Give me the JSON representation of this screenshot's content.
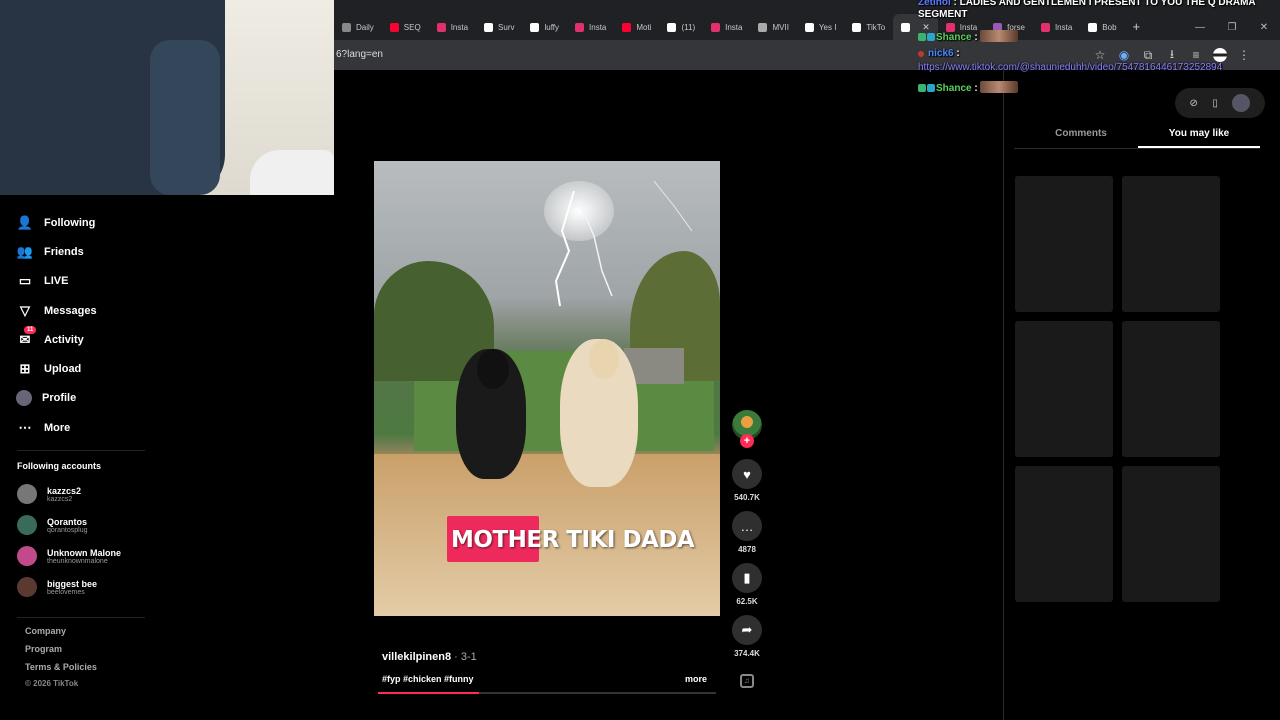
{
  "browser": {
    "tabs": [
      {
        "label": "Daily",
        "color": "#888888"
      },
      {
        "label": "SEQ",
        "color": "#ff0033"
      },
      {
        "label": "Insta",
        "color": "#e1306c"
      },
      {
        "label": "Surv",
        "color": "#ffffff"
      },
      {
        "label": "luffy",
        "color": "#ffffff"
      },
      {
        "label": "Insta",
        "color": "#e1306c"
      },
      {
        "label": "Moti",
        "color": "#ff0033"
      },
      {
        "label": "(11)",
        "color": "#ffffff"
      },
      {
        "label": "Insta",
        "color": "#e1306c"
      },
      {
        "label": "MVII",
        "color": "#aaaaaa"
      },
      {
        "label": "Yes I",
        "color": "#ffffff"
      },
      {
        "label": "TikTo",
        "color": "#ffffff"
      },
      {
        "label": "",
        "color": "#ffffff",
        "active": true
      },
      {
        "label": "Insta",
        "color": "#e1306c"
      },
      {
        "label": "forse",
        "color": "#9b59b6"
      },
      {
        "label": "Insta",
        "color": "#e1306c"
      },
      {
        "label": "Bob",
        "color": "#ffffff"
      }
    ],
    "url": "6?lang=en"
  },
  "sidebar": {
    "nav": [
      {
        "label": "Following",
        "icon": "following-icon"
      },
      {
        "label": "Friends",
        "icon": "friends-icon"
      },
      {
        "label": "LIVE",
        "icon": "live-icon"
      },
      {
        "label": "Messages",
        "icon": "messages-icon"
      },
      {
        "label": "Activity",
        "icon": "activity-icon",
        "badge": "11"
      },
      {
        "label": "Upload",
        "icon": "upload-icon"
      },
      {
        "label": "Profile",
        "icon": "profile-icon"
      },
      {
        "label": "More",
        "icon": "more-icon"
      }
    ],
    "following_title": "Following accounts",
    "accounts": [
      {
        "name": "kazzcs2",
        "handle": "kazzcs2",
        "color": "#777777"
      },
      {
        "name": "Qorantos",
        "handle": "qorantosplug",
        "color": "#3a6a5a"
      },
      {
        "name": "Unknown Malone",
        "handle": "theunknownmalone",
        "color": "#c04a8a"
      },
      {
        "name": "biggest bee",
        "handle": "beelovemes",
        "color": "#5a3a30"
      }
    ],
    "footer": {
      "company": "Company",
      "program": "Program",
      "terms": "Terms & Policies",
      "copyright": "© 2026 TikTok"
    }
  },
  "video": {
    "caption": "MOTHER TIKI DADA",
    "author": "villekilpinen8",
    "date": " · 3-1",
    "tags": "#fyp #chicken #funny",
    "more": "more",
    "progress": 0.3
  },
  "actions": {
    "likes": "540.7K",
    "comments": "4878",
    "saves": "62.5K",
    "shares": "374.4K"
  },
  "right_panel": {
    "tab_comments": "Comments",
    "tab_you_may_like": "You may like"
  },
  "chat": [
    {
      "user": "Zetinol",
      "color": "#5b7bff",
      "message": "LADIES AND GENTLEMEN I PRESENT TO YOU THE Q DRAMA",
      "cont": "SEGMENT"
    },
    {
      "user": "Shance",
      "color": "#5ad15a",
      "message": ""
    },
    {
      "user": "nick6",
      "color": "#4a8aff",
      "message": "",
      "link": "https://www.tiktok.com/@shaunieduhh/video/7547816446173252894"
    },
    {
      "user": "Shance",
      "color": "#5ad15a",
      "message": ""
    }
  ]
}
